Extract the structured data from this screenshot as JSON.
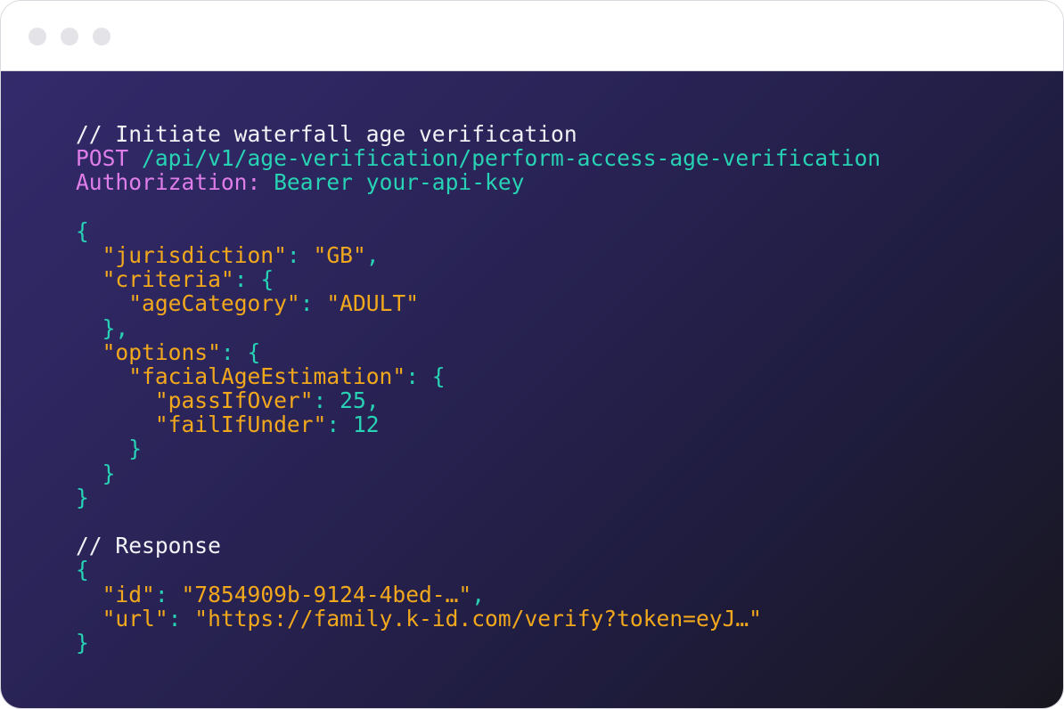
{
  "window": {
    "dots": [
      "window-dot",
      "window-dot",
      "window-dot"
    ]
  },
  "colors": {
    "comment": "#f2f2f7",
    "method": "#df7ee8",
    "teal": "#27d3b4",
    "orange": "#f2a81d",
    "background_start": "#332a6b",
    "background_end": "#18171f"
  },
  "request": {
    "comment": "// Initiate waterfall age verification",
    "method": "POST",
    "path": "/api/v1/age-verification/perform-access-age-verification",
    "auth_key": "Authorization:",
    "auth_value": "Bearer your-api-key",
    "body": {
      "open_brace": "{",
      "jurisdiction_key": "\"jurisdiction\"",
      "jurisdiction_value": "\"GB\"",
      "criteria_key": "\"criteria\"",
      "ageCategory_key": "\"ageCategory\"",
      "ageCategory_value": "\"ADULT\"",
      "options_key": "\"options\"",
      "facialAgeEstimation_key": "\"facialAgeEstimation\"",
      "passIfOver_key": "\"passIfOver\"",
      "passIfOver_value": "25",
      "failIfUnder_key": "\"failIfUnder\"",
      "failIfUnder_value": "12",
      "close_brace": "}"
    }
  },
  "response": {
    "comment": "// Response",
    "open_brace": "{",
    "id_key": "\"id\"",
    "id_value": "\"7854909b-9124-4bed-…\"",
    "url_key": "\"url\"",
    "url_value": "\"https://family.k-id.com/verify?token=eyJ…\"",
    "close_brace": "}"
  }
}
